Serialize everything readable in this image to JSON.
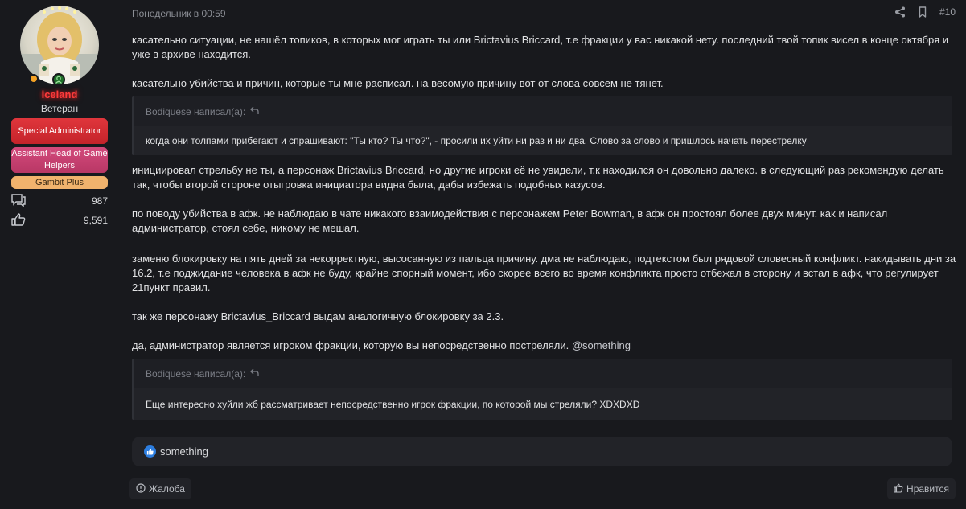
{
  "user": {
    "username": "iceland",
    "title": "Ветеран",
    "banners": [
      "Special Administrator",
      "Assistant Head of Game Helpers",
      "Gambit Plus"
    ],
    "stats": [
      {
        "icon": "messages-icon",
        "value": "987"
      },
      {
        "icon": "reaction-score-icon",
        "value": "9,591"
      }
    ],
    "colors": {
      "username": "#ff3b3b",
      "online": "#f4a224"
    }
  },
  "post": {
    "date": "Понедельник в 00:59",
    "number": "#10",
    "paragraphs": {
      "p1": "касательно ситуации, не нашёл топиков, в которых мог играть ты или Brictavius Briccard, т.е фракции у вас никакой нету. последний твой топик висел в конце октября и уже в архиве находится.",
      "p2": "касательно убийства и причин, которые ты мне расписал. на весомую причину вот от слова совсем не тянет.",
      "p3": "инициировал стрельбу не ты, а персонаж Brictavius Briccard, но другие игроки её не увидели, т.к находился он довольно далеко. в следующий раз рекомендую делать так, чтобы второй стороне отыгровка инициатора видна была, дабы избежать подобных казусов.",
      "p4": "по поводу убийства в афк. не наблюдаю в чате никакого взаимодействия с персонажем Peter Bowman, в афк он простоял более двух минут. как и написал администратор, стоял себе, никому не мешал.",
      "p5": "заменю блокировку на пять дней за некорректную, высосанную из пальца причину. дма не наблюдаю, подтекстом был рядовой словесный конфликт. накидывать дни за 16.2, т.е поджидание человека в афк не буду, крайне спорный момент, ибо скорее всего во время конфликта просто отбежал в сторону и встал в афк, что регулирует 21пункт правил.",
      "p6": "так же персонажу Brictavius_Briccard выдам аналогичную блокировку за 2.3.",
      "p7_text": "да, администратор является игроком фракции, которую вы непосредственно постреляли. ",
      "p7_mention": "@something"
    },
    "quotes": [
      {
        "author": "Bodiquese написал(а):",
        "text": "когда они толпами прибегают и спрашивают: \"Ты кто? Ты что?\", - просили их уйти ни раз и ни два. Слово за слово и пришлось начать перестрелку"
      },
      {
        "author": "Bodiquese написал(а):",
        "text": "Еще интересно хуйли жб рассматривает непосредственно игрок фракции, по которой мы стреляли? XDXDXD"
      }
    ],
    "reactions": {
      "users": "something"
    },
    "footer": {
      "report": "Жалоба",
      "like": "Нравится"
    }
  }
}
